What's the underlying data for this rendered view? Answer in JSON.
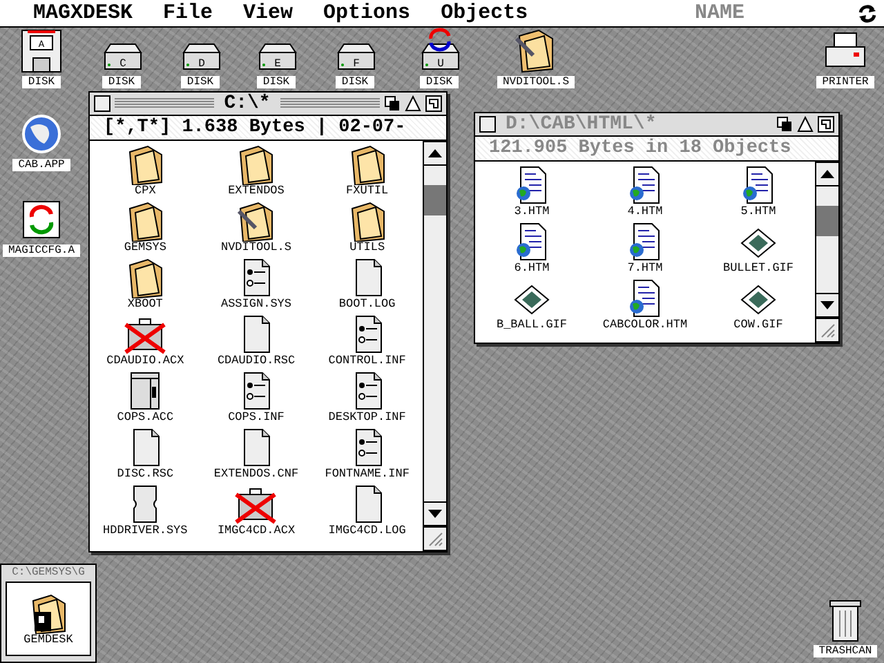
{
  "menu_bar": {
    "app": "MAGXDESK",
    "menus": [
      "File",
      "View",
      "Options",
      "Objects"
    ],
    "user": "NAME"
  },
  "desktop_icons": [
    {
      "label": "DISK",
      "kind": "floppy",
      "letter": "A"
    },
    {
      "label": "DISK",
      "kind": "drive",
      "letter": "C"
    },
    {
      "label": "DISK",
      "kind": "drive",
      "letter": "D"
    },
    {
      "label": "DISK",
      "kind": "drive",
      "letter": "E"
    },
    {
      "label": "DISK",
      "kind": "drive",
      "letter": "F"
    },
    {
      "label": "DISK",
      "kind": "drive-sync",
      "letter": "U"
    },
    {
      "label": "NVDITOOL.S",
      "kind": "folder-tool"
    },
    {
      "label": "PRINTER",
      "kind": "printer"
    },
    {
      "label": "CAB.APP",
      "kind": "globe"
    },
    {
      "label": "MAGICCFG.A",
      "kind": "sync-app"
    },
    {
      "label": "TRASHCAN",
      "kind": "trash"
    }
  ],
  "windows": [
    {
      "title": "C:\\*",
      "active": true,
      "info": "[*,T*]   1.638 Bytes | 02-07-",
      "items": [
        {
          "label": "CPX",
          "kind": "folder"
        },
        {
          "label": "EXTENDOS",
          "kind": "folder"
        },
        {
          "label": "FXUTIL",
          "kind": "folder"
        },
        {
          "label": "GEMSYS",
          "kind": "folder"
        },
        {
          "label": "NVDITOOL.S",
          "kind": "folder-tool"
        },
        {
          "label": "UTILS",
          "kind": "folder"
        },
        {
          "label": "XBOOT",
          "kind": "folder"
        },
        {
          "label": "ASSIGN.SYS",
          "kind": "inf"
        },
        {
          "label": "BOOT.LOG",
          "kind": "doc"
        },
        {
          "label": "CDAUDIO.ACX",
          "kind": "acx"
        },
        {
          "label": "CDAUDIO.RSC",
          "kind": "doc"
        },
        {
          "label": "CONTROL.INF",
          "kind": "inf"
        },
        {
          "label": "COPS.ACC",
          "kind": "acc"
        },
        {
          "label": "COPS.INF",
          "kind": "inf"
        },
        {
          "label": "DESKTOP.INF",
          "kind": "inf"
        },
        {
          "label": "DISC.RSC",
          "kind": "doc"
        },
        {
          "label": "EXTENDOS.CNF",
          "kind": "doc"
        },
        {
          "label": "FONTNAME.INF",
          "kind": "inf"
        },
        {
          "label": "HDDRIVER.SYS",
          "kind": "driver"
        },
        {
          "label": "IMGC4CD.ACX",
          "kind": "acx"
        },
        {
          "label": "IMGC4CD.LOG",
          "kind": "doc"
        }
      ]
    },
    {
      "title": "D:\\CAB\\HTML\\*",
      "active": false,
      "info": "121.905 Bytes in 18 Objects",
      "items": [
        {
          "label": "3.HTM",
          "kind": "htm"
        },
        {
          "label": "4.HTM",
          "kind": "htm"
        },
        {
          "label": "5.HTM",
          "kind": "htm"
        },
        {
          "label": "6.HTM",
          "kind": "htm"
        },
        {
          "label": "7.HTM",
          "kind": "htm"
        },
        {
          "label": "BULLET.GIF",
          "kind": "gif"
        },
        {
          "label": "B_BALL.GIF",
          "kind": "gif"
        },
        {
          "label": "CABCOLOR.HTM",
          "kind": "htm"
        },
        {
          "label": "COW.GIF",
          "kind": "gif"
        }
      ]
    }
  ],
  "iconified_window": {
    "title": "C:\\GEMSYS\\G",
    "item": {
      "label": "GEMDESK",
      "kind": "folder-app"
    }
  }
}
